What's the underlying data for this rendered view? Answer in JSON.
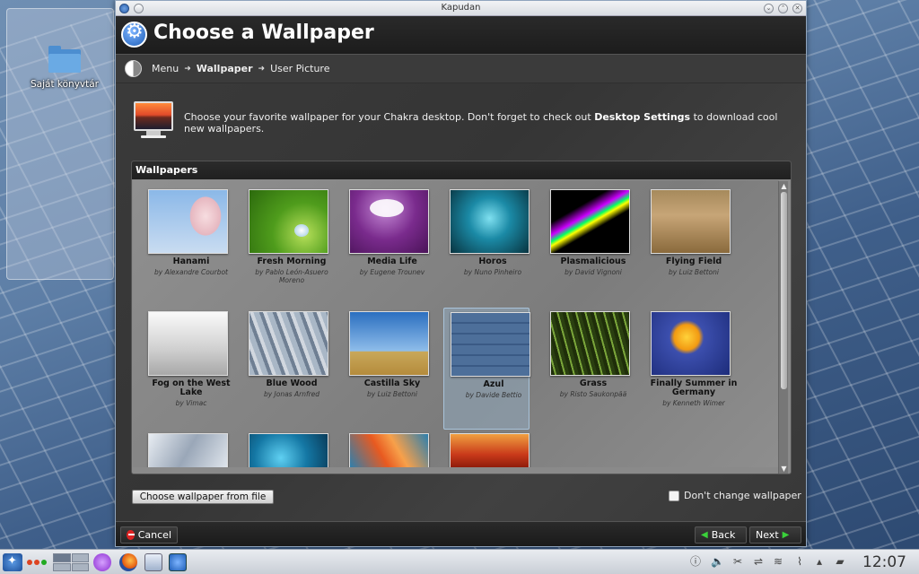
{
  "desktop": {
    "folder_label": "Saját könyvtár"
  },
  "window": {
    "title": "Kapudan"
  },
  "header": {
    "title": "Choose a Wallpaper"
  },
  "breadcrumb": {
    "items": [
      "Menu",
      "Wallpaper",
      "User Picture"
    ]
  },
  "intro": {
    "text_before": "Choose your favorite wallpaper for your Chakra desktop. Don't forget to check out ",
    "link": "Desktop Settings",
    "text_after": " to download cool new wallpapers."
  },
  "wallpapers": {
    "header": "Wallpapers",
    "items": [
      {
        "name": "Hanami",
        "author": "by Alexandre Courbot"
      },
      {
        "name": "Fresh Morning",
        "author": "by Pablo León-Asuero Moreno"
      },
      {
        "name": "Media Life",
        "author": "by Eugene Trounev"
      },
      {
        "name": "Horos",
        "author": "by Nuno Pinheiro"
      },
      {
        "name": "Plasmalicious",
        "author": "by David Vignoni"
      },
      {
        "name": "Flying Field",
        "author": "by Luiz Bettoni"
      },
      {
        "name": "Fog on the West Lake",
        "author": "by Vimac"
      },
      {
        "name": "Blue Wood",
        "author": "by Jonas Arnfred"
      },
      {
        "name": "Castilla Sky",
        "author": "by Luiz Bettoni"
      },
      {
        "name": "Azul",
        "author": "by Davide Bettio"
      },
      {
        "name": "Grass",
        "author": "by Risto Saukonpää"
      },
      {
        "name": "Finally Summer in Germany",
        "author": "by Kenneth Wimer"
      }
    ],
    "selected": "Azul"
  },
  "buttons": {
    "choose_file": "Choose wallpaper from file",
    "dont_change": "Don't change wallpaper",
    "cancel": "Cancel",
    "back": "Back",
    "next": "Next"
  },
  "taskbar": {
    "clock": "12:07"
  }
}
